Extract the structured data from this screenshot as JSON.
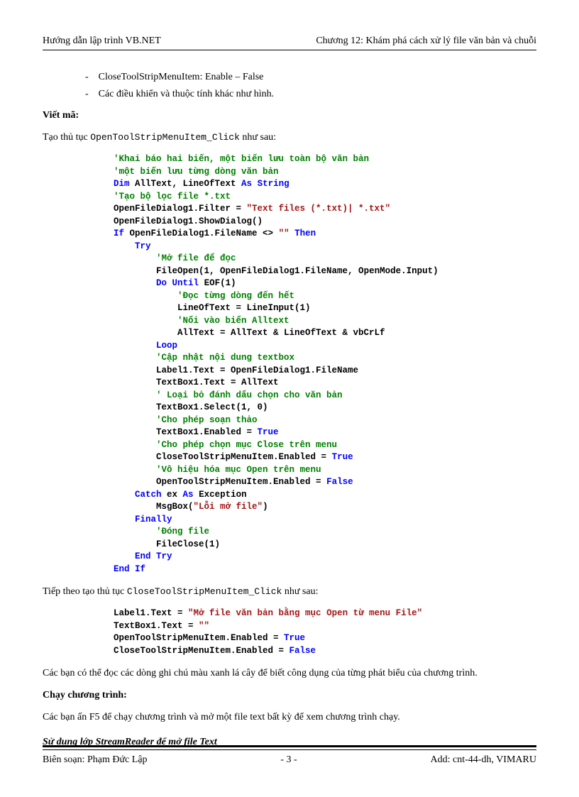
{
  "header": {
    "left": "Hướng dẫn lập trình VB.NET",
    "right": "Chương 12: Khám phá cách xử lý file văn bản và chuỗi"
  },
  "bullets": {
    "b1": "CloseToolStripMenuItem:   Enable – False",
    "b2": "Các điều khiển và thuộc tính khác như hình."
  },
  "sections": {
    "write_code": "Viết mã:",
    "run_program": "Chạy chương trình:"
  },
  "paras": {
    "p1a": "Tạo thủ tục ",
    "p1b": "OpenToolStripMenuItem_Click",
    "p1c": " như sau:",
    "p2a": "Tiếp theo tạo thủ tục ",
    "p2b": "CloseToolStripMenuItem_Click",
    "p2c": " như sau:",
    "p3": "Các bạn có thể đọc các dòng ghi chú màu xanh lá cây để biết công dụng của từng phát biểu của chương trình.",
    "p4": "Các bạn ấn F5 để chạy chương trình và mở một file text bất kỳ để xem chương trình chạy.",
    "p5": "Sử dụng lớp StreamReader để mở file Text"
  },
  "code1": {
    "l01": "'Khai báo hai biến, một biến lưu toàn bộ văn bản",
    "l02": "'một biến lưu từng dòng văn bản",
    "l03a": "Dim",
    "l03b": " AllText, LineOfText ",
    "l03c": "As",
    "l03d": " ",
    "l03e": "String",
    "l04": "'Tạo bộ lọc file *.txt",
    "l05a": "OpenFileDialog1.Filter = ",
    "l05b": "\"Text files (*.txt)| *.txt\"",
    "l06": "OpenFileDialog1.ShowDialog()",
    "l07a": "If",
    "l07b": " OpenFileDialog1.FileName <> ",
    "l07c": "\"\"",
    "l07d": " ",
    "l07e": "Then",
    "l08": "Try",
    "l09": "'Mở file để đọc",
    "l10": "FileOpen(1, OpenFileDialog1.FileName, OpenMode.Input)",
    "l11a": "Do",
    "l11b": " ",
    "l11c": "Until",
    "l11d": " EOF(1)",
    "l12": "'Đọc từng dòng đến hết",
    "l13": "LineOfText = LineInput(1)",
    "l14": "'Nối vào biến Alltext",
    "l15": "AllText = AllText & LineOfText & vbCrLf",
    "l16": "Loop",
    "l17": "'Cập nhật nội dung textbox",
    "l18": "Label1.Text = OpenFileDialog1.FileName",
    "l19": "TextBox1.Text = AllText",
    "l20": "' Loại bỏ đánh dấu chọn cho văn bản",
    "l21": "TextBox1.Select(1, 0)",
    "l22": "'Cho phép soạn thảo",
    "l23a": "TextBox1.Enabled = ",
    "l23b": "True",
    "l24": "'Cho phép chọn mục Close trên menu",
    "l25a": "CloseToolStripMenuItem.Enabled = ",
    "l25b": "True",
    "l26": "'Vô hiệu hóa mục Open trên menu",
    "l27a": "OpenToolStripMenuItem.Enabled = ",
    "l27b": "False",
    "l28a": "Catch",
    "l28b": " ex ",
    "l28c": "As",
    "l28d": " Exception",
    "l29a": "MsgBox(",
    "l29b": "\"Lỗi mở file\"",
    "l29c": ")",
    "l30": "Finally",
    "l31": "'Đóng file",
    "l32": "FileClose(1)",
    "l33a": "End",
    "l33b": " ",
    "l33c": "Try",
    "l34a": "End",
    "l34b": " ",
    "l34c": "If"
  },
  "code2": {
    "l1a": "Label1.Text = ",
    "l1b": "\"Mở file văn bản bằng mục Open từ menu File\"",
    "l2a": "TextBox1.Text = ",
    "l2b": "\"\"",
    "l3a": "OpenToolStripMenuItem.Enabled = ",
    "l3b": "True",
    "l4a": "CloseToolStripMenuItem.Enabled = ",
    "l4b": "False"
  },
  "footer": {
    "left": "Biên soạn: Phạm Đức Lập",
    "center": "- 3 -",
    "right": "Add: cnt-44-dh, VIMARU"
  }
}
